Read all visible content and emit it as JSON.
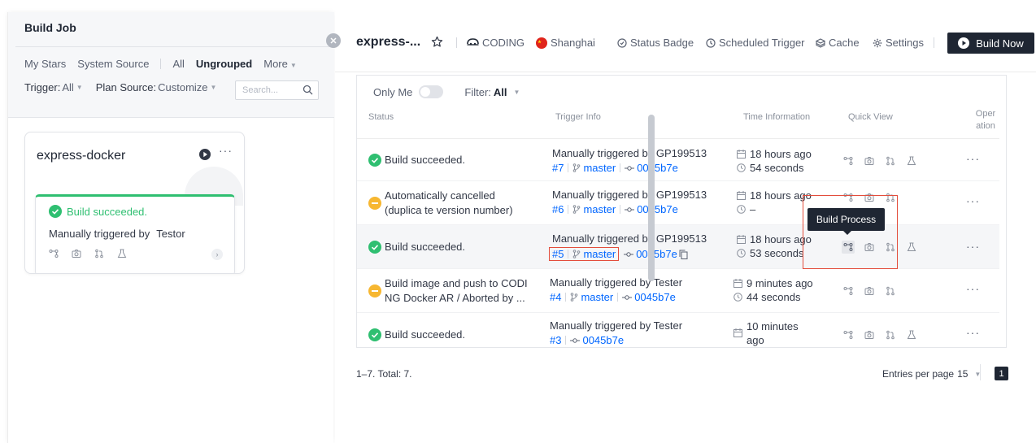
{
  "left": {
    "title": "Build Job",
    "nav": [
      "My Stars",
      "System Source",
      "All",
      "Ungrouped",
      "More"
    ],
    "trigger_label": "Trigger:",
    "trigger_value": "All",
    "plan_label": "Plan Source:",
    "plan_value": "Customize",
    "search_placeholder": "Search...",
    "job": {
      "name": "express-docker",
      "more": "···",
      "status": "Build succeeded.",
      "trigger_text": "Manually triggered by",
      "trigger_user": "Testor",
      "chevron": "›"
    }
  },
  "header": {
    "job_title": "express-...",
    "team": "CODING",
    "region": "Shanghai",
    "status_badge": "Status Badge",
    "scheduled_trigger": "Scheduled Trigger",
    "cache": "Cache",
    "settings": "Settings",
    "build_now": "Build Now"
  },
  "table": {
    "only_me": "Only Me",
    "filter_label": "Filter:",
    "filter_value": "All",
    "columns": [
      "Status",
      "Trigger Info",
      "Time Information",
      "Quick View",
      "Oper ation"
    ],
    "rows": [
      {
        "status": "Build succeeded.",
        "trigger": "Manually triggered by GP199513",
        "num": "#7",
        "branch": "master",
        "commit": "0045b7e",
        "date": "18 hours ago",
        "duration": "54 seconds",
        "op": "···"
      },
      {
        "status": "Automatically cancelled (duplica te version number)",
        "trigger": "Manually triggered by GP199513",
        "num": "#6",
        "branch": "master",
        "commit": "0045b7e",
        "date": "18 hours ago",
        "duration": "–",
        "op": "···"
      },
      {
        "status": "Build succeeded.",
        "trigger": "Manually triggered by GP199513",
        "num": "#5",
        "branch": "master",
        "commit": "0045b7e",
        "date": "18 hours ago",
        "duration": "53 seconds",
        "op": "···"
      },
      {
        "status": "Build image and push to CODI NG Docker AR / Aborted by ...",
        "trigger": "Manually triggered by Tester",
        "num": "#4",
        "branch": "master",
        "commit": "0045b7e",
        "date": "9 minutes ago",
        "duration": "44 seconds",
        "op": "···"
      },
      {
        "status": "Build succeeded.",
        "trigger": "Manually triggered by Tester",
        "num": "#3",
        "commit": "0045b7e",
        "date": "10 minutes ago",
        "op": "···"
      }
    ],
    "tooltip": "Build Process"
  },
  "footer": {
    "total": "1–7. Total: 7.",
    "per_page_label": "Entries per page",
    "per_page": "15",
    "page": "1"
  },
  "colors": {
    "success": "#2fbf71",
    "warning": "#f7b731",
    "link": "#0066ff",
    "highlight": "#e34d3c",
    "dark": "#1f2633"
  }
}
